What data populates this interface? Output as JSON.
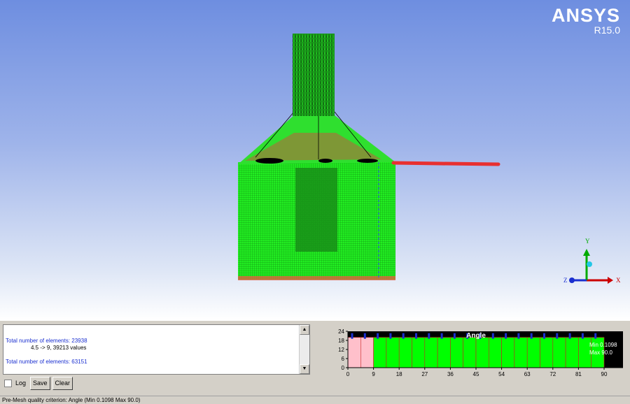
{
  "brand": {
    "name": "ANSYS",
    "release": "R15.0"
  },
  "viewport": {
    "triad": {
      "x_label": "X",
      "y_label": "Y",
      "z_label": "Z",
      "x_color": "#cc0000",
      "y_color": "#00aa00",
      "z_color": "#1a2fd0"
    }
  },
  "console": {
    "lines": [
      {
        "text": "Total number of elements: 23938",
        "style": "blue"
      },
      {
        "text": "4.5 -> 9, 39213 values",
        "style": "black"
      },
      {
        "text": "Total number of elements: 63151",
        "style": "blue"
      }
    ]
  },
  "controls": {
    "log_label": "Log",
    "log_checked": false,
    "save_label": "Save",
    "clear_label": "Clear"
  },
  "chart_data": {
    "type": "bar",
    "title": "Angle",
    "x_ticks": [
      0,
      9,
      18,
      27,
      36,
      45,
      54,
      63,
      72,
      81,
      90
    ],
    "y_ticks": [
      0,
      6,
      12,
      18,
      24
    ],
    "xlim": [
      0,
      90
    ],
    "ylim": [
      0,
      24
    ],
    "bin_width": 4.5,
    "bins_highlighted_range": [
      0,
      9
    ],
    "highlight_color": "#ffc0cb",
    "bar_color": "#00ff00",
    "bar_height_level": 20,
    "min_label": "Min 0.1098",
    "max_label": "Max 90.0"
  },
  "status": {
    "text": "Pre-Mesh quality criterion: Angle (Min 0.1098 Max 90.0)"
  }
}
